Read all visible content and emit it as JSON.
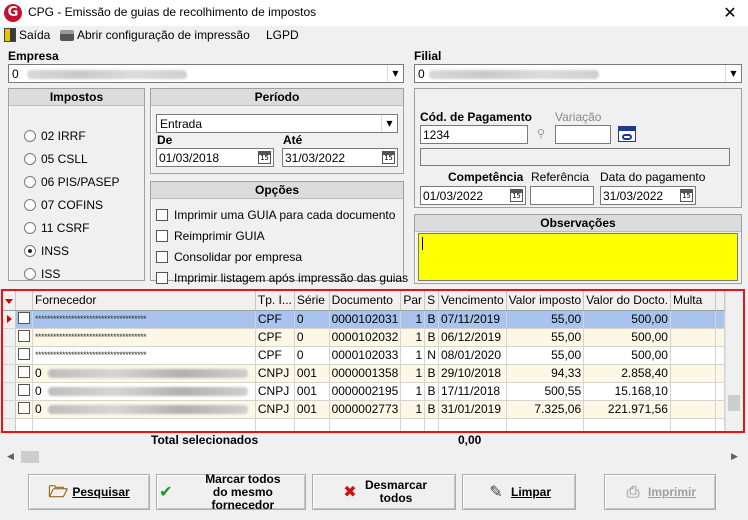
{
  "window": {
    "title": "CPG - Emissão de guias de recolhimento de impostos",
    "close": "✕"
  },
  "menu": {
    "exit": "Saída",
    "print_config": "Abrir configuração de impressão",
    "lgpd": "LGPD"
  },
  "empresa": {
    "label": "Empresa",
    "value": "0"
  },
  "filial": {
    "label": "Filial",
    "value": "0"
  },
  "impostos": {
    "title": "Impostos",
    "options": [
      {
        "label": "02 IRRF",
        "selected": false
      },
      {
        "label": "05 CSLL",
        "selected": false
      },
      {
        "label": "06 PIS/PASEP",
        "selected": false
      },
      {
        "label": "07 COFINS",
        "selected": false
      },
      {
        "label": "11 CSRF",
        "selected": false
      },
      {
        "label": "INSS",
        "selected": true
      },
      {
        "label": "ISS",
        "selected": false
      }
    ]
  },
  "periodo": {
    "title": "Período",
    "tipo": "Entrada",
    "de_label": "De",
    "de_value": "01/03/2018",
    "ate_label": "Até",
    "ate_value": "31/03/2022",
    "cal_icon": "15"
  },
  "opcoes": {
    "title": "Opções",
    "items": [
      "Imprimir uma GUIA para cada documento",
      "Reimprimir GUIA",
      "Consolidar por empresa",
      "Imprimir listagem após impressão das guias"
    ]
  },
  "pagamento": {
    "cod_label": "Cód. de Pagamento",
    "cod_value": "1234",
    "variacao_label": "Variação",
    "variacao_value": "",
    "competencia_label": "Competência",
    "competencia_value": "01/03/2022",
    "referencia_label": "Referência",
    "referencia_value": "",
    "data_pag_label": "Data do pagamento",
    "data_pag_value": "31/03/2022"
  },
  "observacoes": {
    "title": "Observações",
    "value": ""
  },
  "grid": {
    "columns": [
      "Fornecedor",
      "Tp. I...",
      "Série",
      "Documento",
      "Par",
      "S",
      "Vencimento",
      "Valor imposto",
      "Valor do Docto.",
      "Multa"
    ],
    "rows": [
      {
        "fornecedor": "*************************************",
        "masked": true,
        "tp": "CPF",
        "serie": "0",
        "documento": "0000102031",
        "par": "1",
        "s": "B",
        "vencimento": "07/11/2019",
        "valor_imposto": "55,00",
        "valor_docto": "500,00",
        "multa": ""
      },
      {
        "fornecedor": "*************************************",
        "masked": true,
        "tp": "CPF",
        "serie": "0",
        "documento": "0000102032",
        "par": "1",
        "s": "B",
        "vencimento": "06/12/2019",
        "valor_imposto": "55,00",
        "valor_docto": "500,00",
        "multa": ""
      },
      {
        "fornecedor": "*************************************",
        "masked": true,
        "tp": "CPF",
        "serie": "0",
        "documento": "0000102033",
        "par": "1",
        "s": "N",
        "vencimento": "08/01/2020",
        "valor_imposto": "55,00",
        "valor_docto": "500,00",
        "multa": ""
      },
      {
        "fornecedor": "0",
        "masked": false,
        "tp": "CNPJ",
        "serie": "001",
        "documento": "0000001358",
        "par": "1",
        "s": "B",
        "vencimento": "29/10/2018",
        "valor_imposto": "94,33",
        "valor_docto": "2.858,40",
        "multa": ""
      },
      {
        "fornecedor": "0",
        "masked": false,
        "tp": "CNPJ",
        "serie": "001",
        "documento": "0000002195",
        "par": "1",
        "s": "B",
        "vencimento": "17/11/2018",
        "valor_imposto": "500,55",
        "valor_docto": "15.168,10",
        "multa": ""
      },
      {
        "fornecedor": "0",
        "masked": false,
        "tp": "CNPJ",
        "serie": "001",
        "documento": "0000002773",
        "par": "1",
        "s": "B",
        "vencimento": "31/01/2019",
        "valor_imposto": "7.325,06",
        "valor_docto": "221.971,56",
        "multa": ""
      }
    ]
  },
  "totals": {
    "label": "Total selecionados",
    "value": "0,00"
  },
  "buttons": {
    "pesquisar": "Pesquisar",
    "marcar_line1": "Marcar todos",
    "marcar_line2": "do mesmo fornecedor",
    "desmarcar_line1": "Desmarcar",
    "desmarcar_line2": "todos",
    "limpar": "Limpar",
    "imprimir": "Imprimir"
  }
}
